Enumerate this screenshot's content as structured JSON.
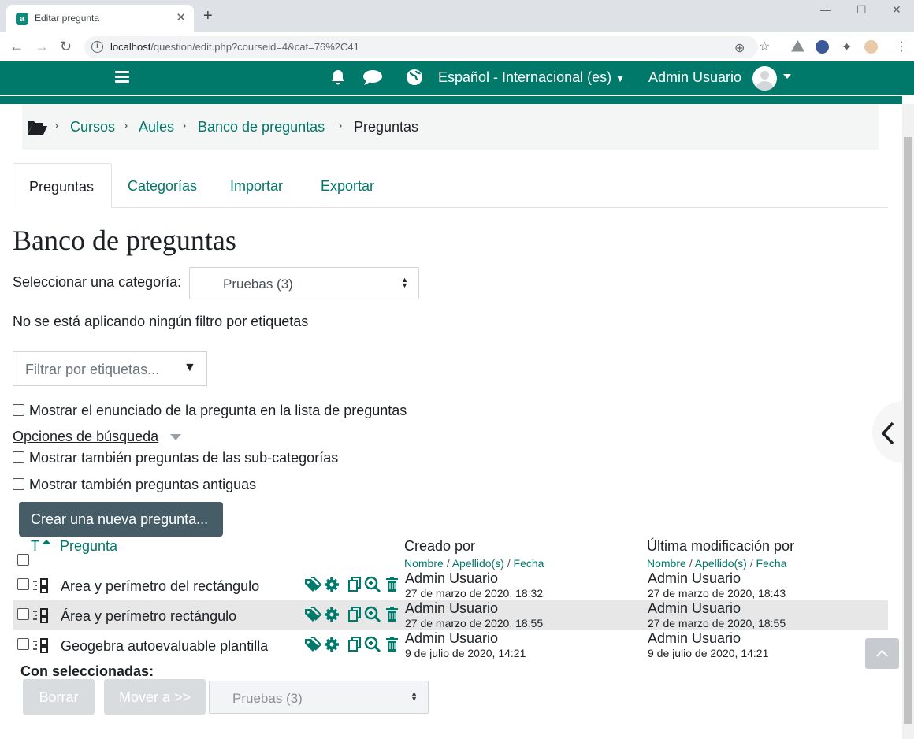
{
  "browser": {
    "tab_title": "Editar pregunta",
    "url_host": "localhost",
    "url_path": "/question/edit.php?courseid=4&cat=76%2C41"
  },
  "navbar": {
    "language": "Español - Internacional (es)",
    "user_name": "Admin Usuario"
  },
  "breadcrumb": [
    "Cursos",
    "Aules",
    "Banco de preguntas",
    "Preguntas"
  ],
  "tabs": [
    "Preguntas",
    "Categorías",
    "Importar",
    "Exportar"
  ],
  "page": {
    "heading": "Banco de preguntas",
    "category_label": "Seleccionar una categoría:",
    "category_value": "Pruebas (3)",
    "no_filter_text": "No se está aplicando ningún filtro por etiquetas",
    "tag_filter_placeholder": "Filtrar por etiquetas...",
    "show_text_label": "Mostrar el enunciado de la pregunta en la lista de preguntas",
    "search_options_label": "Opciones de búsqueda",
    "show_subcat_label": "Mostrar también preguntas de las sub-categorías",
    "show_old_label": "Mostrar también preguntas antiguas",
    "create_button": "Crear una nueva pregunta..."
  },
  "table": {
    "col_type": "T",
    "col_question": "Pregunta",
    "col_created": "Creado por",
    "col_modified": "Última modificación por",
    "sub_first": "Nombre",
    "sub_last": "Apellido(s)",
    "sub_date": "Fecha",
    "separator": "/",
    "rows": [
      {
        "name": "Area y perímetro del rectángulo",
        "created_by": "Admin Usuario",
        "created_date": "27 de marzo de 2020, 18:32",
        "modified_by": "Admin Usuario",
        "modified_date": "27 de marzo de 2020, 18:43"
      },
      {
        "name": "Área y perímetro rectángulo",
        "created_by": "Admin Usuario",
        "created_date": "27 de marzo de 2020, 18:55",
        "modified_by": "Admin Usuario",
        "modified_date": "27 de marzo de 2020, 18:55"
      },
      {
        "name": "Geogebra autoevaluable plantilla",
        "created_by": "Admin Usuario",
        "created_date": "9 de julio de 2020, 14:21",
        "modified_by": "Admin Usuario",
        "modified_date": "9 de julio de 2020, 14:21"
      }
    ]
  },
  "bulk": {
    "label": "Con seleccionadas:",
    "delete_button": "Borrar",
    "move_button": "Mover a >>",
    "target_value": "Pruebas (3)"
  },
  "colors": {
    "brand": "#00786a",
    "button_dark": "#465d68"
  }
}
